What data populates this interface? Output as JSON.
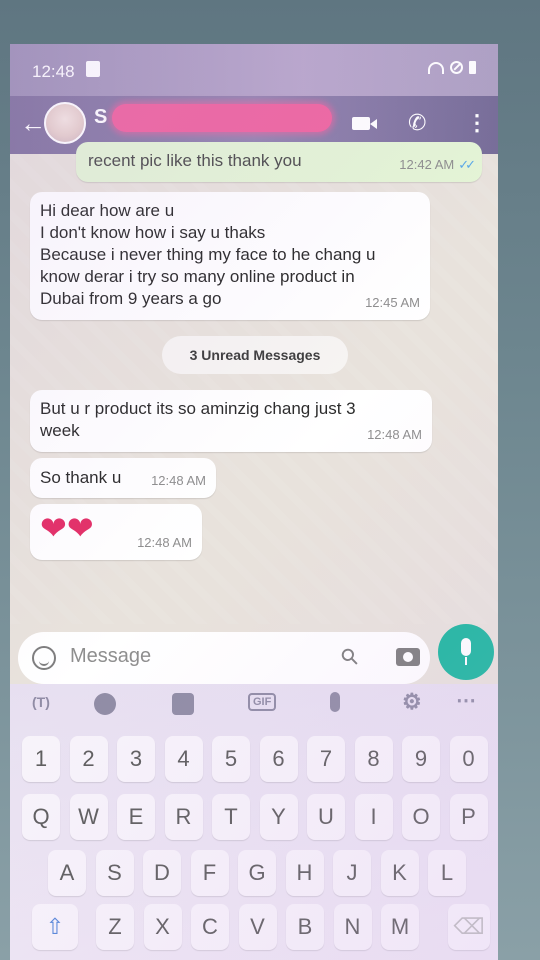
{
  "status_bar": {
    "time": "12:48"
  },
  "header": {
    "contact_initial": "S"
  },
  "messages": [
    {
      "text": "recent pic like this thank you",
      "time": "12:42 AM",
      "ticks": "✓✓"
    },
    {
      "text": "Hi dear how are u\nI don't know how i say u thaks\nBecause i never thing my face to he chang u\nknow derar i try so many online product in\nDubai from 9 years a go",
      "time": "12:45 AM"
    },
    {
      "text": "But u r product its so aminzig chang just 3\nweek",
      "time": "12:48 AM"
    },
    {
      "text": "So thank u",
      "time": "12:48 AM"
    },
    {
      "text": "",
      "emoji": "❤❤",
      "time": "12:48 AM"
    }
  ],
  "unread_label": "3 Unread Messages",
  "input": {
    "placeholder": "Message"
  },
  "keyboard": {
    "toolbar": {
      "gif": "GIF"
    },
    "row_numbers": [
      "1",
      "2",
      "3",
      "4",
      "5",
      "6",
      "7",
      "8",
      "9",
      "0"
    ],
    "row1": [
      "Q",
      "W",
      "E",
      "R",
      "T",
      "Y",
      "U",
      "I",
      "O",
      "P"
    ],
    "row2": [
      "A",
      "S",
      "D",
      "F",
      "G",
      "H",
      "J",
      "K",
      "L"
    ],
    "row3": [
      "Z",
      "X",
      "C",
      "V",
      "B",
      "N",
      "M"
    ]
  },
  "colors": {
    "accent": "#0fb49a",
    "header": "#8f80ad",
    "heart": "#e2245f",
    "read_ticks": "#4fa3e6"
  }
}
